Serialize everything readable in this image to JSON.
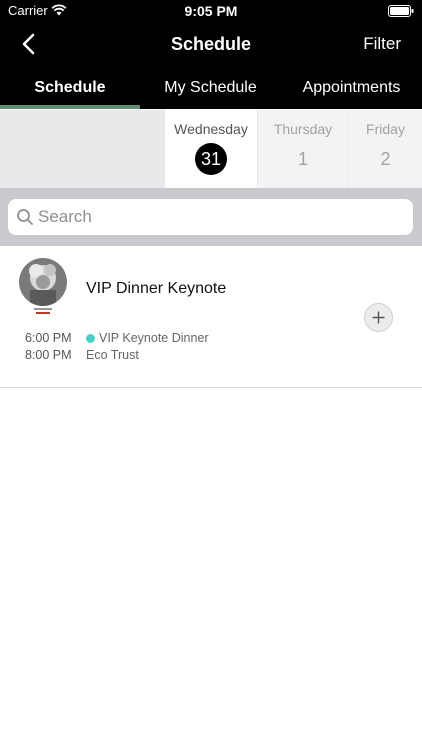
{
  "status_bar": {
    "carrier": "Carrier",
    "time": "9:05 PM"
  },
  "nav": {
    "title": "Schedule",
    "filter_label": "Filter"
  },
  "tabs": [
    {
      "label": "Schedule",
      "selected": true
    },
    {
      "label": "My Schedule",
      "selected": false
    },
    {
      "label": "Appointments",
      "selected": false
    }
  ],
  "days": [
    {
      "name": "Wednesday",
      "number": "31",
      "selected": true
    },
    {
      "name": "Thursday",
      "number": "1",
      "selected": false
    },
    {
      "name": "Friday",
      "number": "2",
      "selected": false
    }
  ],
  "search": {
    "placeholder": "Search",
    "value": ""
  },
  "events": [
    {
      "title": "VIP Dinner Keynote",
      "start": "6:00 PM",
      "end": "8:00 PM",
      "session": "VIP Keynote Dinner",
      "location": "Eco Trust"
    }
  ],
  "colors": {
    "header_bg": "#000000",
    "tab_underline": "#5f8e75",
    "session_dot": "#4ecdc4",
    "search_area": "#c9c9ce"
  }
}
